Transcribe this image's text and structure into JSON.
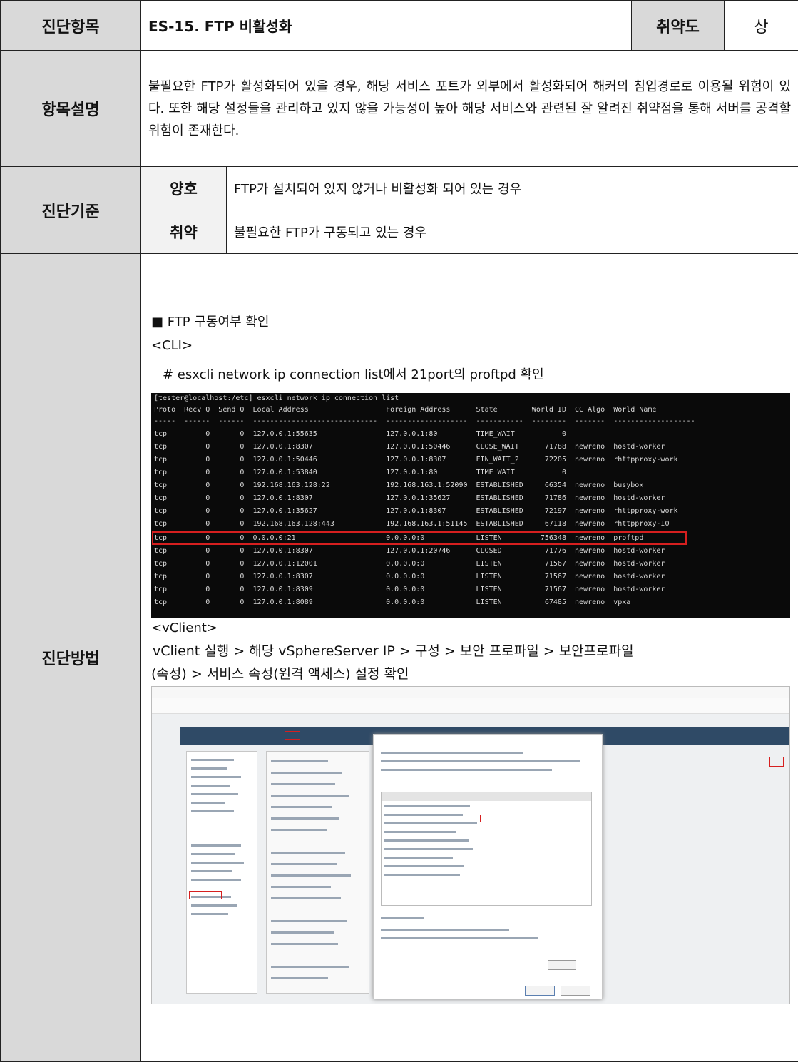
{
  "header": {
    "label": "진단항목",
    "title": "ES-15. FTP 비활성화",
    "severity_label": "취약도",
    "severity_value": "상"
  },
  "description": {
    "label": "항목설명",
    "text": " 불필요한 FTP가 활성화되어 있을 경우, 해당 서비스 포트가 외부에서 활성화되어 해커의 침입경로로 이용될 위험이 있다. 또한 해당 설정들을 관리하고 있지 않을 가능성이 높아 해당 서비스와 관련된 잘 알려진 취약점을 통해 서버를 공격할 위험이 존재한다."
  },
  "criteria": {
    "label": "진단기준",
    "good_label": "양호",
    "good_text": "FTP가 설치되어 있지 않거나 비활성화 되어 있는 경우",
    "bad_label": "취약",
    "bad_text": "불필요한 FTP가 구동되고 있는 경우"
  },
  "method": {
    "label": "진단방법",
    "bullet": "■ FTP 구동여부 확인",
    "cli_tag": "<CLI>",
    "cli_desc": "# esxcli network ip connection list에서 21port의 proftpd 확인",
    "vclient_tag": "<vClient>",
    "vclient_line1": "vClient 실행 > 해당 vSphereServer IP > 구성 > 보안 프로파일 > 보안프로파일",
    "vclient_line2": "(속성) > 서비스 속성(원격 액세스) 설정 확인"
  },
  "terminal": {
    "prompt": "[tester@localhost:/etc] esxcli network ip connection list",
    "header": "Proto  Recv Q  Send Q  Local Address                  Foreign Address      State        World ID  CC Algo  World Name",
    "separator": "-----  ------  ------  -----------------------------  -------------------  -----------  --------  -------  -------------------",
    "rows": [
      "tcp         0       0  127.0.0.1:55635                127.0.0.1:80         TIME_WAIT           0",
      "tcp         0       0  127.0.0.1:8307                 127.0.0.1:50446      CLOSE_WAIT      71788  newreno  hostd-worker",
      "tcp         0       0  127.0.0.1:50446                127.0.0.1:8307       FIN_WAIT_2      72205  newreno  rhttpproxy-work",
      "tcp         0       0  127.0.0.1:53840                127.0.0.1:80         TIME_WAIT           0",
      "tcp         0       0  192.168.163.128:22             192.168.163.1:52090  ESTABLISHED     66354  newreno  busybox",
      "tcp         0       0  127.0.0.1:8307                 127.0.0.1:35627      ESTABLISHED     71786  newreno  hostd-worker",
      "tcp         0       0  127.0.0.1:35627                127.0.0.1:8307       ESTABLISHED     72197  newreno  rhttpproxy-work",
      "tcp         0       0  192.168.163.128:443            192.168.163.1:51145  ESTABLISHED     67118  newreno  rhttpproxy-IO",
      "tcp         0       0  0.0.0.0:21                     0.0.0.0:0            LISTEN         756348  newreno  proftpd",
      "tcp         0       0  127.0.0.1:8307                 127.0.0.1:20746      CLOSED          71776  newreno  hostd-worker",
      "tcp         0       0  127.0.0.1:12001                0.0.0.0:0            LISTEN          71567  newreno  hostd-worker",
      "tcp         0       0  127.0.0.1:8307                 0.0.0.0:0            LISTEN          71567  newreno  hostd-worker",
      "tcp         0       0  127.0.0.1:8309                 0.0.0.0:0            LISTEN          71567  newreno  hostd-worker",
      "tcp         0       0  127.0.0.1:8089                 0.0.0.0:0            LISTEN          67485  newreno  vpxa"
    ]
  },
  "colors": {
    "header_bg": "#d9d9d9",
    "criteria_label_bg": "#f2f2f2",
    "highlight": "#d61f1f",
    "terminal_bg": "#0a0a0a"
  }
}
